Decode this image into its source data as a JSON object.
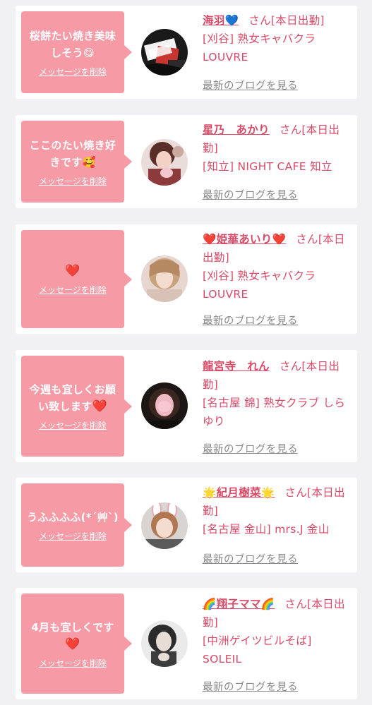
{
  "colors": {
    "page_bg": "#f1f1f3",
    "card_bg": "#ffffff",
    "bubble": "#f69aa6",
    "accent_text": "#d84a67",
    "link_gray": "#8a8a8a"
  },
  "delete_label": "メッセージを削除",
  "blog_link_label": "最新のブログを見る",
  "cards": [
    {
      "message_text": "桜餅たい焼き美味しそう",
      "message_emoji": "😋",
      "name": "海羽",
      "name_suffix_emoji": "💙",
      "san": "さん[本日出勤]",
      "shop": "[刈谷] 熟女キャバクラ LOUVRE"
    },
    {
      "message_text": "ここのたい焼き好きです",
      "message_emoji": "🥰",
      "name": "星乃　あかり",
      "san": "さん[本日出勤]",
      "shop": "[知立] NIGHT CAFE 知立"
    },
    {
      "message_text": "",
      "message_emoji": "❤️",
      "name_prefix_emoji": "❤️",
      "name": "姫華あいり",
      "name_suffix_emoji": "❤️",
      "san": "さん[本日出勤]",
      "shop": "[刈谷] 熟女キャバクラ LOUVRE"
    },
    {
      "message_text": "今週も宜しくお願い致します",
      "message_emoji": "❤️",
      "name": "龍宮寺　れん",
      "san": "さん[本日出勤]",
      "shop": "[名古屋 錦] 熟女クラブ しらゆり"
    },
    {
      "message_text": "うふふふふ(*´艸`)",
      "name_prefix_emoji": "🌟",
      "name": "紀月樹菜",
      "name_suffix_emoji": "🌟",
      "san": "さん[本日出勤]",
      "shop": "[名古屋 金山] mrs.J 金山"
    },
    {
      "message_text": "4月も宜しくです",
      "message_emoji": "❤️",
      "name_prefix_emoji": "🌈",
      "name": "翔子ママ",
      "name_suffix_emoji": "🌈",
      "san": "さん[本日出勤]",
      "shop": "[中洲ゲイツビルそば] SOLEIL"
    }
  ]
}
